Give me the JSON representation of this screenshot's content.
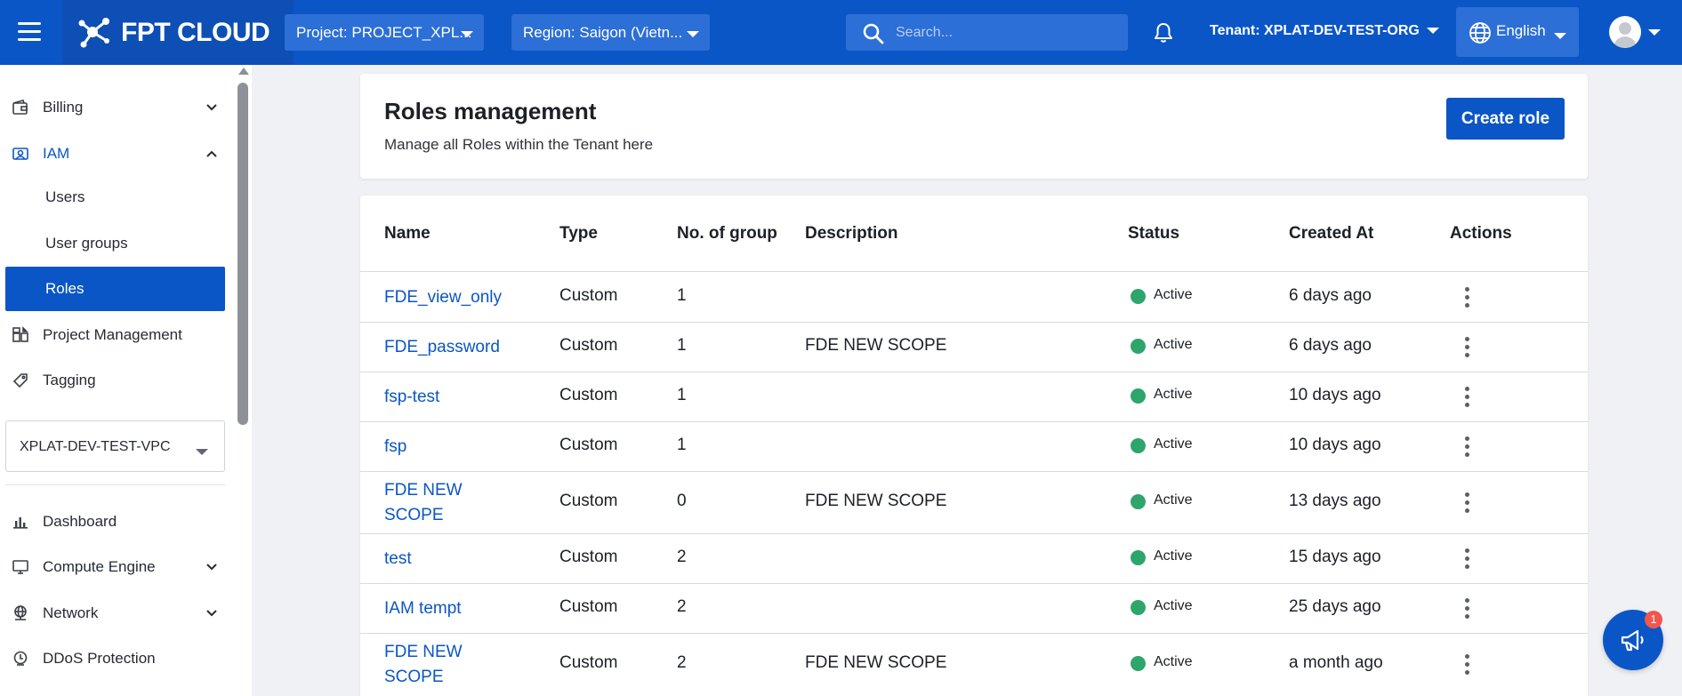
{
  "app": {
    "logo_text": "FPT CLOUD",
    "project_selector": "Project: PROJECT_XPL...",
    "region_selector": "Region: Saigon (Vietn...",
    "search_placeholder": "Search...",
    "tenant": "Tenant: XPLAT-DEV-TEST-ORG",
    "language": "English",
    "brand_color": "#0b56c6"
  },
  "sidebar": {
    "items": [
      {
        "label": "Billing",
        "icon": "wallet-icon"
      },
      {
        "label": "IAM",
        "icon": "iam-icon"
      },
      {
        "label": "Users"
      },
      {
        "label": "User groups"
      },
      {
        "label": "Roles"
      },
      {
        "label": "Project Management",
        "icon": "project-icon"
      },
      {
        "label": "Tagging",
        "icon": "tag-icon"
      },
      {
        "label": "Dashboard",
        "icon": "chart-icon"
      },
      {
        "label": "Compute Engine",
        "icon": "monitor-icon"
      },
      {
        "label": "Network",
        "icon": "globe-network-icon"
      },
      {
        "label": "DDoS Protection",
        "icon": "ddos-icon"
      }
    ],
    "vpc_selector": "XPLAT-DEV-TEST-VPC"
  },
  "header": {
    "title": "Roles management",
    "subtitle": "Manage all Roles within the Tenant here",
    "create_button": "Create role"
  },
  "table": {
    "columns": [
      "Name",
      "Type",
      "No. of group",
      "Description",
      "Status",
      "Created At",
      "Actions"
    ],
    "rows": [
      {
        "name": "FDE_view_only",
        "type": "Custom",
        "groups": "1",
        "description": "",
        "status": "Active",
        "created": "6 days ago"
      },
      {
        "name": "FDE_password",
        "type": "Custom",
        "groups": "1",
        "description": "FDE NEW SCOPE",
        "status": "Active",
        "created": "6 days ago"
      },
      {
        "name": "fsp-test",
        "type": "Custom",
        "groups": "1",
        "description": "",
        "status": "Active",
        "created": "10 days ago"
      },
      {
        "name": "fsp",
        "type": "Custom",
        "groups": "1",
        "description": "",
        "status": "Active",
        "created": "10 days ago"
      },
      {
        "name": "FDE NEW SCOPE",
        "type": "Custom",
        "groups": "0",
        "description": "FDE NEW SCOPE",
        "status": "Active",
        "created": "13 days ago"
      },
      {
        "name": "test",
        "type": "Custom",
        "groups": "2",
        "description": "",
        "status": "Active",
        "created": "15 days ago"
      },
      {
        "name": "IAM tempt",
        "type": "Custom",
        "groups": "2",
        "description": "",
        "status": "Active",
        "created": "25 days ago"
      },
      {
        "name": "FDE NEW SCOPE",
        "type": "Custom",
        "groups": "2",
        "description": "FDE NEW SCOPE",
        "status": "Active",
        "created": "a month ago"
      }
    ],
    "status_color": "#2ea56b"
  },
  "notification_badge": "1"
}
